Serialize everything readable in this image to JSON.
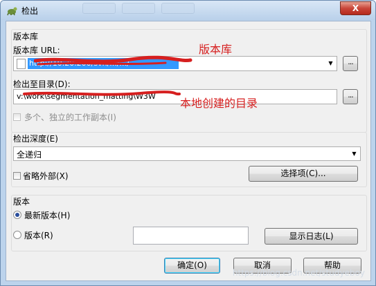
{
  "window": {
    "title": "检出",
    "close_label": "X"
  },
  "repository": {
    "group_label": "版本库",
    "url_label": "版本库 URL:",
    "url_value": "http://10.20.200/svn/.../.../",
    "checkout_dir_label": "检出至目录(D):",
    "checkout_dir_value": "v:\\work\\segmentation_matting\\W3W",
    "browse_label": "...",
    "multi_checkbox_label": "多个、独立的工作副本(I)"
  },
  "annotations": {
    "repo_note": "版本库",
    "dir_note": "本地创建的目录",
    "colors": {
      "annotation": "#d61f1f",
      "url_highlight": "#3399ff"
    }
  },
  "depth": {
    "label": "检出深度(E)",
    "selected": "全递归",
    "omit_externals_label": "省略外部(X)",
    "options_button": "选择项(C)..."
  },
  "revision": {
    "group_label": "版本",
    "head_label": "最新版本(H)",
    "revision_label": "版本(R)",
    "revision_value": "",
    "show_log_button": "显示日志(L)"
  },
  "buttons": {
    "ok": "确定(O)",
    "cancel": "取消",
    "help": "帮助"
  },
  "watermark": "https://blog.csdn.net/studyeboy"
}
